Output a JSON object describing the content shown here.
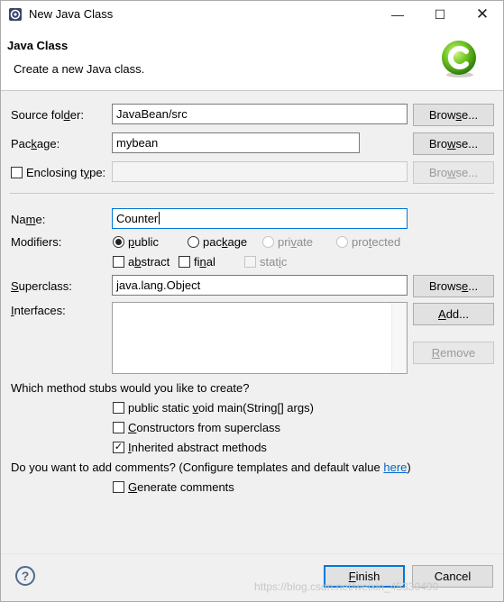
{
  "window": {
    "title": "New Java Class",
    "minimize": "—",
    "maximize": "☐",
    "close": "✕"
  },
  "banner": {
    "title": "Java Class",
    "subtitle": "Create a new Java class.",
    "logo": "class-wizard-icon"
  },
  "source_folder": {
    "label_pre": "Source fol",
    "label_u": "d",
    "label_post": "er:",
    "value": "JavaBean/src",
    "browse": "Brow",
    "browse_u": "s",
    "browse_post": "e..."
  },
  "package": {
    "label_pre": "Pac",
    "label_u": "k",
    "label_post": "age:",
    "value": "mybean",
    "browse": "Bro",
    "browse_u": "w",
    "browse_post": "se..."
  },
  "enclosing": {
    "label_pre": "Enclosing t",
    "label_u": "y",
    "label_post": "pe:",
    "checked": false,
    "value": "",
    "browse": "Bro",
    "browse_u": "w",
    "browse_post": "se..."
  },
  "name": {
    "label_pre": "Na",
    "label_u": "m",
    "label_post": "e:",
    "value": "Counter"
  },
  "modifiers": {
    "label": "Modifiers:",
    "public": {
      "pre": "",
      "u": "p",
      "post": "ublic",
      "selected": true
    },
    "package": {
      "pre": "pac",
      "u": "k",
      "post": "age",
      "selected": false
    },
    "private": {
      "pre": "pri",
      "u": "v",
      "post": "ate",
      "selected": false
    },
    "protected": {
      "pre": "pro",
      "u": "t",
      "post": "ected",
      "selected": false
    },
    "abstract": {
      "pre": "a",
      "u": "b",
      "post": "stract",
      "checked": false
    },
    "final": {
      "pre": "fi",
      "u": "n",
      "post": "al",
      "checked": false
    },
    "static": {
      "pre": "stat",
      "u": "i",
      "post": "c",
      "checked": false
    }
  },
  "superclass": {
    "label_pre": "",
    "label_u": "S",
    "label_post": "uperclass:",
    "value": "java.lang.Object",
    "browse": "Brows",
    "browse_u": "e",
    "browse_post": "..."
  },
  "interfaces": {
    "label_pre": "",
    "label_u": "I",
    "label_post": "nterfaces:",
    "add_pre": "",
    "add_u": "A",
    "add_post": "dd...",
    "remove_pre": "",
    "remove_u": "R",
    "remove_post": "emove"
  },
  "stubs": {
    "question": "Which method stubs would you like to create?",
    "main": {
      "pre": "public static ",
      "u": "v",
      "post": "oid main(String[] args)",
      "checked": false
    },
    "constructors": {
      "pre": "",
      "u": "C",
      "post": "onstructors from superclass",
      "checked": false
    },
    "inherited": {
      "pre": "",
      "u": "I",
      "post": "nherited abstract methods",
      "checked": true
    }
  },
  "comments": {
    "question": "Do you want to add comments? (Configure templates and default value ",
    "link": "here",
    "question_end": ")",
    "generate": {
      "pre": "",
      "u": "G",
      "post": "enerate comments",
      "checked": false
    }
  },
  "footer": {
    "help": "?",
    "finish_pre": "",
    "finish_u": "F",
    "finish_post": "inish",
    "cancel": "Cancel",
    "watermark": "https://blog.csdn.net/weixin_45330490"
  },
  "check_glyph": "✓"
}
